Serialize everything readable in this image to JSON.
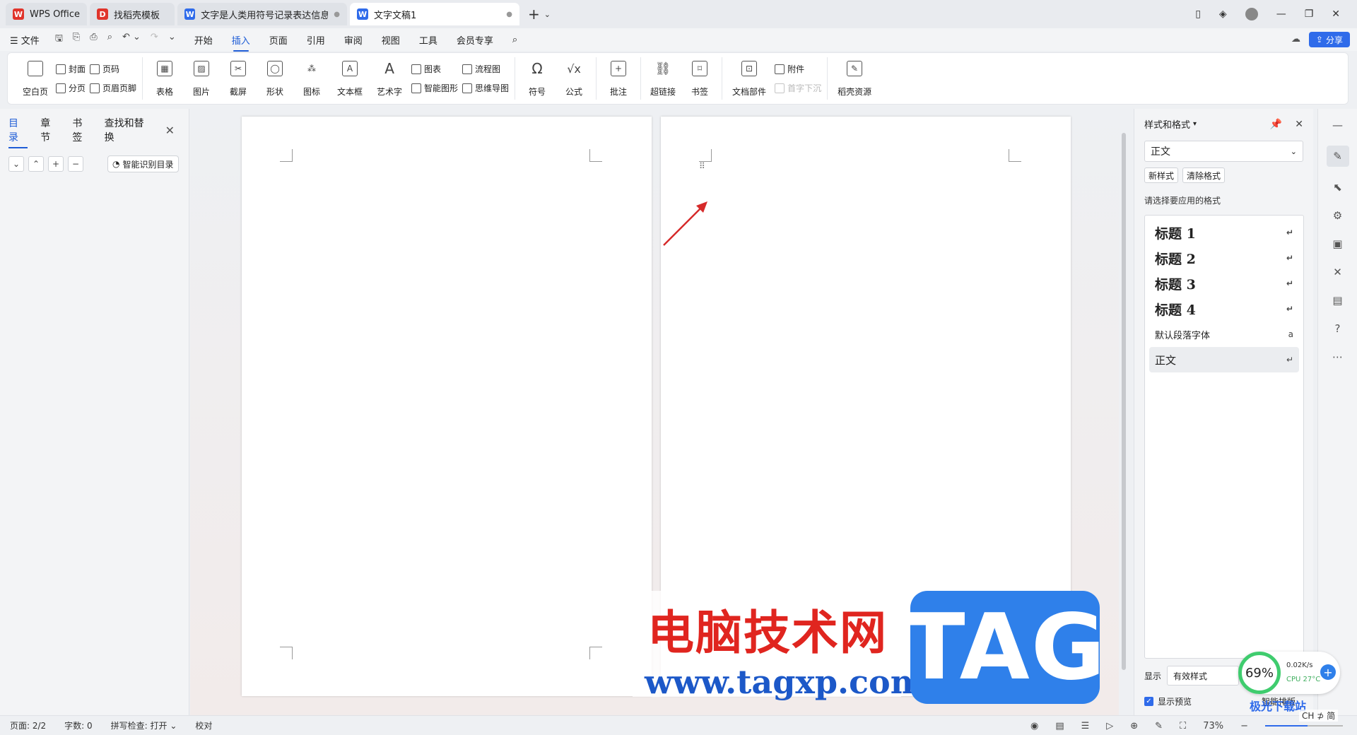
{
  "tabs": [
    {
      "label": "WPS Office",
      "logo": "W",
      "color": "#e0342b",
      "active": false
    },
    {
      "label": "找稻壳模板",
      "logo": "稻",
      "color": "#e0342b",
      "active": false
    },
    {
      "label": "文字是人类用符号记录表达信息以",
      "logo": "W",
      "color": "#2f6bea",
      "active": false
    },
    {
      "label": "文字文稿1",
      "logo": "W",
      "color": "#2f6bea",
      "active": true
    }
  ],
  "menu": {
    "file": "文件",
    "items": [
      "开始",
      "插入",
      "页面",
      "引用",
      "审阅",
      "视图",
      "工具",
      "会员专享"
    ],
    "active": "插入",
    "share": "分享"
  },
  "ribbon": {
    "blank_page": "空白页",
    "cover": "封面",
    "page_break": "分页",
    "page_number": "页码",
    "header_footer": "页眉页脚",
    "table": "表格",
    "picture": "图片",
    "screenshot": "截屏",
    "shape": "形状",
    "icon": "图标",
    "textbox": "文本框",
    "wordart": "艺术字",
    "chart": "图表",
    "smart_graphic": "智能图形",
    "flowchart": "流程图",
    "mindmap": "思维导图",
    "symbol": "符号",
    "formula": "公式",
    "comment": "批注",
    "hyperlink": "超链接",
    "bookmark": "书签",
    "doc_parts": "文档部件",
    "attachment": "附件",
    "drop_cap": "首字下沉",
    "docer_resources": "稻壳资源"
  },
  "nav": {
    "tabs": [
      "目录",
      "章节",
      "书签",
      "查找和替换"
    ],
    "active": "目录",
    "smart_toc": "智能识别目录"
  },
  "style_pane": {
    "title": "样式和格式",
    "current": "正文",
    "new_style": "新样式",
    "clear_format": "清除格式",
    "prompt": "请选择要应用的格式",
    "items": [
      {
        "label": "标题 1",
        "mark": "↵"
      },
      {
        "label": "标题 2",
        "mark": "↵"
      },
      {
        "label": "标题 3",
        "mark": "↵"
      },
      {
        "label": "标题 4",
        "mark": "↵"
      },
      {
        "label": "默认段落字体",
        "mark": "a"
      },
      {
        "label": "正文",
        "mark": "↵"
      }
    ],
    "show_label": "显示",
    "show_value": "有效样式",
    "preview": "显示预览",
    "smart_layout": "智能排版"
  },
  "status": {
    "page": "页面: 2/2",
    "words": "字数: 0",
    "spell": "拼写检查: 打开",
    "proof": "校对",
    "zoom": "73%"
  },
  "watermark": {
    "cn": "电脑技术网",
    "url": "www.tagxp.com",
    "tag": "TAG",
    "site": "极光下载站"
  },
  "perf": {
    "percent": "69%",
    "net": "0.02K/s",
    "cpu": "CPU 27°C"
  },
  "ime": "CH ⊅ 简",
  "colors": {
    "accent": "#1f5dd6",
    "arrow": "#d62a2a"
  }
}
